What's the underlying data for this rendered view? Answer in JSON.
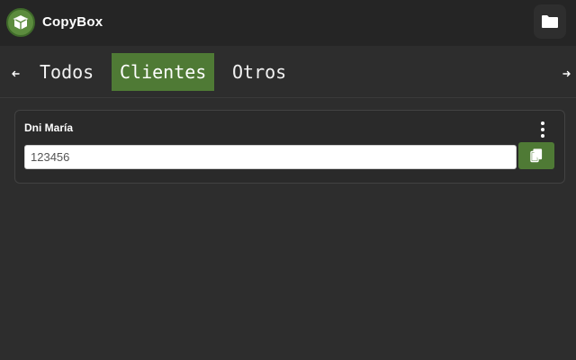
{
  "app": {
    "title": "CopyBox",
    "logo_icon": "box-icon",
    "accent": "#4f7a35"
  },
  "header": {
    "folder_icon": "folder-icon"
  },
  "tabs": {
    "prev_icon": "arrow-left-icon",
    "next_icon": "arrow-right-icon",
    "items": [
      {
        "label": "Todos",
        "active": false
      },
      {
        "label": "Clientes",
        "active": true
      },
      {
        "label": "Otros",
        "active": false
      }
    ]
  },
  "entries": [
    {
      "title": "Dni María",
      "value": "123456",
      "menu_icon": "kebab-menu-icon",
      "copy_icon": "copy-icon"
    }
  ]
}
